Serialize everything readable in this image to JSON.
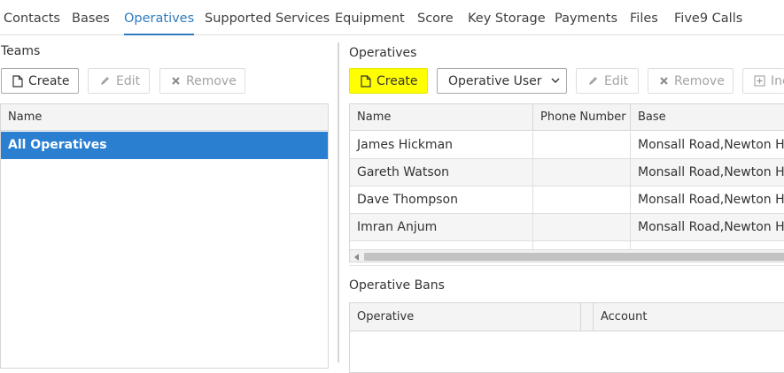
{
  "tabs": [
    {
      "label": "Contacts",
      "active": false
    },
    {
      "label": "Bases",
      "active": false
    },
    {
      "label": "Operatives",
      "active": true
    },
    {
      "label": "Supported Services",
      "active": false
    },
    {
      "label": "Equipment",
      "active": false
    },
    {
      "label": "Score",
      "active": false
    },
    {
      "label": "Key Storage",
      "active": false
    },
    {
      "label": "Payments",
      "active": false
    },
    {
      "label": "Files",
      "active": false
    },
    {
      "label": "Five9 Calls",
      "active": false
    }
  ],
  "teams": {
    "title": "Teams",
    "buttons": {
      "create": "Create",
      "edit": "Edit",
      "remove": "Remove"
    },
    "column_name": "Name",
    "selected_row": "All Operatives"
  },
  "operatives": {
    "title": "Operatives",
    "buttons": {
      "create": "Create",
      "operative_user": "Operative User",
      "edit": "Edit",
      "remove": "Remove",
      "include": "Inc"
    },
    "columns": [
      "Name",
      "Phone Number",
      "Base"
    ],
    "rows": [
      {
        "name": "James Hickman",
        "phone": "",
        "base": "Monsall Road,Newton Hea"
      },
      {
        "name": "Gareth Watson",
        "phone": "",
        "base": "Monsall Road,Newton Hea"
      },
      {
        "name": "Dave Thompson",
        "phone": "",
        "base": "Monsall Road,Newton Hea"
      },
      {
        "name": "Imran Anjum",
        "phone": "",
        "base": "Monsall Road,Newton Hea"
      }
    ]
  },
  "bans": {
    "title": "Operative Bans",
    "columns": [
      "Operative",
      "Account"
    ]
  },
  "colors": {
    "accent": "#2f7bbf",
    "selected_row": "#2b7fd1",
    "highlight": "#ffff00"
  },
  "icons": {
    "create": "file-icon",
    "edit": "pencil-icon",
    "remove": "x-icon",
    "include": "plus-box-icon",
    "dropdown": "chevron-down-icon"
  }
}
